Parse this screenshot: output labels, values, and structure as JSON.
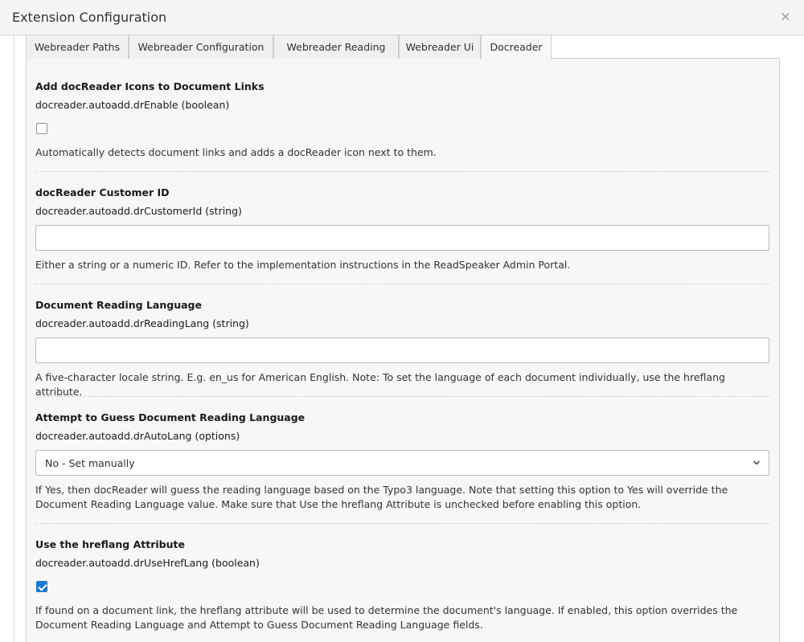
{
  "window": {
    "title": "Extension Configuration",
    "close_glyph": "×"
  },
  "tabs": [
    {
      "label": "Webreader Paths"
    },
    {
      "label": "Webreader Configuration"
    },
    {
      "label": "Webreader Reading"
    },
    {
      "label": "Webreader Ui"
    },
    {
      "label": "Docreader",
      "active": true
    }
  ],
  "fields": [
    {
      "title": "Add docReader Icons to Document Links",
      "key": "docreader.autoadd.drEnable (boolean)",
      "type": "checkbox",
      "checked": false,
      "description": "Automatically detects document links and adds a docReader icon next to them."
    },
    {
      "title": "docReader Customer ID",
      "key": "docreader.autoadd.drCustomerId (string)",
      "type": "text",
      "value": "",
      "description": "Either a string or a numeric ID. Refer to the implementation instructions in the ReadSpeaker Admin Portal."
    },
    {
      "title": "Document Reading Language",
      "key": "docreader.autoadd.drReadingLang (string)",
      "type": "text",
      "value": "",
      "description": "A five-character locale string. E.g. en_us for American English. Note: To set the language of each document individually, use the hreflang attribute."
    },
    {
      "title": "Attempt to Guess Document Reading Language",
      "key": "docreader.autoadd.drAutoLang (options)",
      "type": "select",
      "selected": "No - Set manually",
      "description": "If Yes, then docReader will guess the reading language based on the Typo3 language. Note that setting this option to Yes will override the Document Reading Language value. Make sure that Use the hreflang Attribute is unchecked before enabling this option."
    },
    {
      "title": "Use the hreflang Attribute",
      "key": "docreader.autoadd.drUseHrefLang (boolean)",
      "type": "checkbox",
      "checked": true,
      "description": "If found on a document link, the hreflang attribute will be used to determine the document's language. If enabled, this option overrides the Document Reading Language and Attempt to Guess Document Reading Language fields."
    }
  ],
  "colors": {
    "accent": "#1f78d1",
    "panel_bg": "#f7f7f7",
    "tab_bg": "#f0f0f0"
  }
}
